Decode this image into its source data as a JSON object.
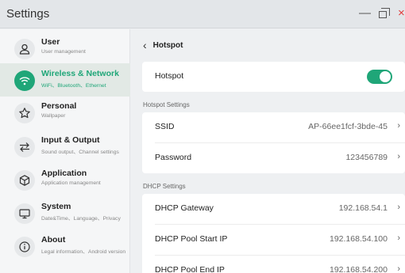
{
  "app": {
    "title": "Settings"
  },
  "window_controls": {
    "minimize": "—",
    "close": "×"
  },
  "sidebar": {
    "items": [
      {
        "label": "User",
        "sub": "User management",
        "icon": "user-icon"
      },
      {
        "label": "Wireless & Network",
        "sub": "WiFi、Bluetooth、Ethernet",
        "icon": "wifi-icon",
        "active": true
      },
      {
        "label": "Personal",
        "sub": "Wallpaper",
        "icon": "star-icon"
      },
      {
        "label": "Input & Output",
        "sub": "Sound output、Channel settings",
        "icon": "swap-arrows-icon"
      },
      {
        "label": "Application",
        "sub": "Application management",
        "icon": "cube-icon"
      },
      {
        "label": "System",
        "sub": "Date&Time、Language、Privacy",
        "icon": "monitor-icon"
      },
      {
        "label": "About",
        "sub": "Legal information、Android version",
        "icon": "info-icon"
      }
    ]
  },
  "main": {
    "back_title": "Hotspot",
    "hotspot_toggle": {
      "label": "Hotspot",
      "on": true
    },
    "hotspot_settings": {
      "title": "Hotspot Settings",
      "ssid": {
        "label": "SSID",
        "value": "AP-66ee1fcf-3bde-45"
      },
      "password": {
        "label": "Password",
        "value": "123456789"
      }
    },
    "dhcp_settings": {
      "title": "DHCP Settings",
      "gateway": {
        "label": "DHCP Gateway",
        "value": "192.168.54.1"
      },
      "pool_start": {
        "label": "DHCP Pool Start IP",
        "value": "192.168.54.100"
      },
      "pool_end": {
        "label": "DHCP Pool End IP",
        "value": "192.168.54.200"
      }
    }
  },
  "colors": {
    "accent": "#1fa678",
    "close": "#e23b3b"
  }
}
